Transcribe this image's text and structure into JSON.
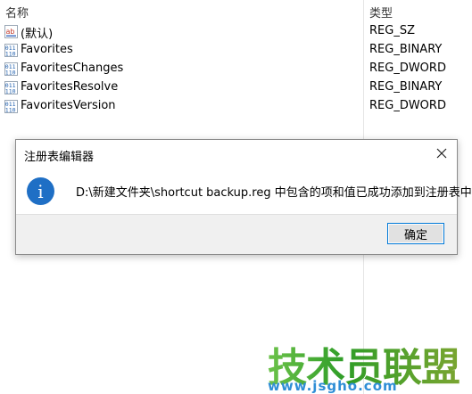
{
  "registry": {
    "columns": {
      "name": "名称",
      "type": "类型"
    },
    "rows": [
      {
        "icon": "string-value-icon",
        "name": "(默认)",
        "type": "REG_SZ"
      },
      {
        "icon": "binary-value-icon",
        "name": "Favorites",
        "type": "REG_BINARY"
      },
      {
        "icon": "binary-value-icon",
        "name": "FavoritesChanges",
        "type": "REG_DWORD"
      },
      {
        "icon": "binary-value-icon",
        "name": "FavoritesResolve",
        "type": "REG_BINARY"
      },
      {
        "icon": "binary-value-icon",
        "name": "FavoritesVersion",
        "type": "REG_DWORD"
      }
    ]
  },
  "dialog": {
    "title": "注册表编辑器",
    "message": "D:\\新建文件夹\\shortcut backup.reg 中包含的项和值已成功添加到注册表中。",
    "ok_label": "确定",
    "icon": "info-icon",
    "info_glyph": "i"
  },
  "watermark": {
    "text": "技术员联盟",
    "url": "www.jsgho.com"
  },
  "colors": {
    "info_blue": "#1f6fc5",
    "button_focus_border": "#0078d7",
    "watermark_green": "#3aa22e",
    "watermark_blue": "#2f8ed6"
  }
}
